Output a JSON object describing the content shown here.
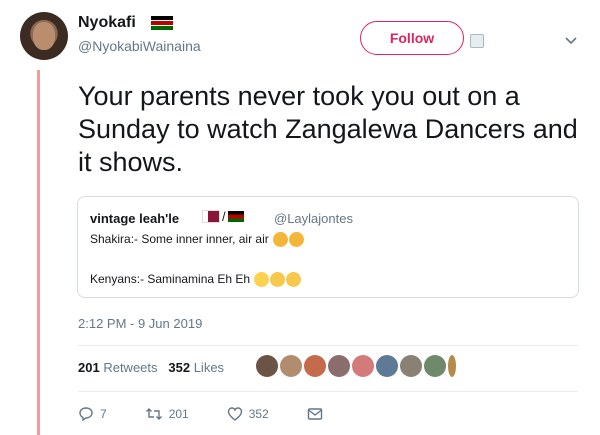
{
  "author": {
    "name": "Nyokafi",
    "handle": "@NyokabiWainaina"
  },
  "follow_label": "Follow",
  "tweet_text": "Your parents never took you out on a Sunday to watch Zangalewa Dancers and it shows.",
  "quote": {
    "name": "vintage leah'le",
    "handle": "@Laylajontes",
    "line1": "Shakira:- Some inner inner, air air",
    "line2": "Kenyans:- Saminamina Eh Eh"
  },
  "timestamp": "2:12 PM - 9 Jun 2019",
  "stats": {
    "retweets_count": "201",
    "retweets_label": "Retweets",
    "likes_count": "352",
    "likes_label": "Likes"
  },
  "actions": {
    "replies": "7",
    "retweets": "201",
    "likes": "352"
  },
  "colors": {
    "accent": "#e0245e",
    "muted": "#657786",
    "rail": "#f39a9a"
  }
}
